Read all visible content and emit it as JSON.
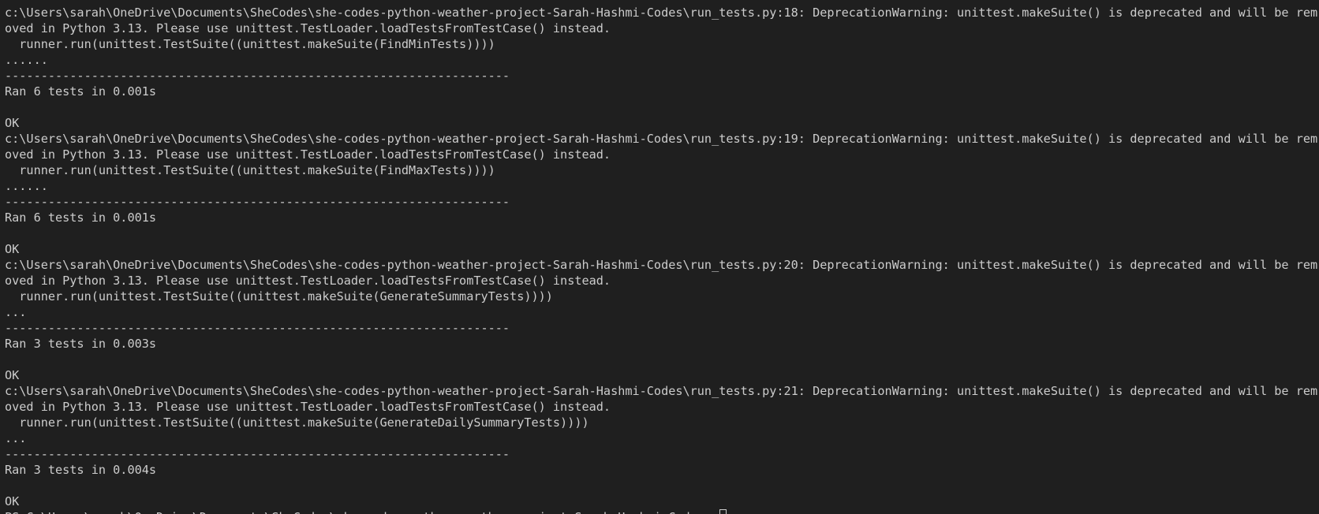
{
  "terminal": {
    "lines": [
      "c:\\Users\\sarah\\OneDrive\\Documents\\SheCodes\\she-codes-python-weather-project-Sarah-Hashmi-Codes\\run_tests.py:18: DeprecationWarning: unittest.makeSuite() is deprecated and will be rem",
      "oved in Python 3.13. Please use unittest.TestLoader.loadTestsFromTestCase() instead.",
      "  runner.run(unittest.TestSuite((unittest.makeSuite(FindMinTests))))",
      "......",
      "----------------------------------------------------------------------",
      "Ran 6 tests in 0.001s",
      "",
      "OK",
      "c:\\Users\\sarah\\OneDrive\\Documents\\SheCodes\\she-codes-python-weather-project-Sarah-Hashmi-Codes\\run_tests.py:19: DeprecationWarning: unittest.makeSuite() is deprecated and will be rem",
      "oved in Python 3.13. Please use unittest.TestLoader.loadTestsFromTestCase() instead.",
      "  runner.run(unittest.TestSuite((unittest.makeSuite(FindMaxTests))))",
      "......",
      "----------------------------------------------------------------------",
      "Ran 6 tests in 0.001s",
      "",
      "OK",
      "c:\\Users\\sarah\\OneDrive\\Documents\\SheCodes\\she-codes-python-weather-project-Sarah-Hashmi-Codes\\run_tests.py:20: DeprecationWarning: unittest.makeSuite() is deprecated and will be rem",
      "oved in Python 3.13. Please use unittest.TestLoader.loadTestsFromTestCase() instead.",
      "  runner.run(unittest.TestSuite((unittest.makeSuite(GenerateSummaryTests))))",
      "...",
      "----------------------------------------------------------------------",
      "Ran 3 tests in 0.003s",
      "",
      "OK",
      "c:\\Users\\sarah\\OneDrive\\Documents\\SheCodes\\she-codes-python-weather-project-Sarah-Hashmi-Codes\\run_tests.py:21: DeprecationWarning: unittest.makeSuite() is deprecated and will be rem",
      "oved in Python 3.13. Please use unittest.TestLoader.loadTestsFromTestCase() instead.",
      "  runner.run(unittest.TestSuite((unittest.makeSuite(GenerateDailySummaryTests))))",
      "...",
      "----------------------------------------------------------------------",
      "Ran 3 tests in 0.004s",
      "",
      "OK"
    ],
    "prompt": "PS C:\\Users\\sarah\\OneDrive\\Documents\\SheCodes\\she-codes-python-weather-project-Sarah-Hashmi-Codes> "
  },
  "colors": {
    "background": "#1f1f1f",
    "foreground": "#cccccc"
  }
}
